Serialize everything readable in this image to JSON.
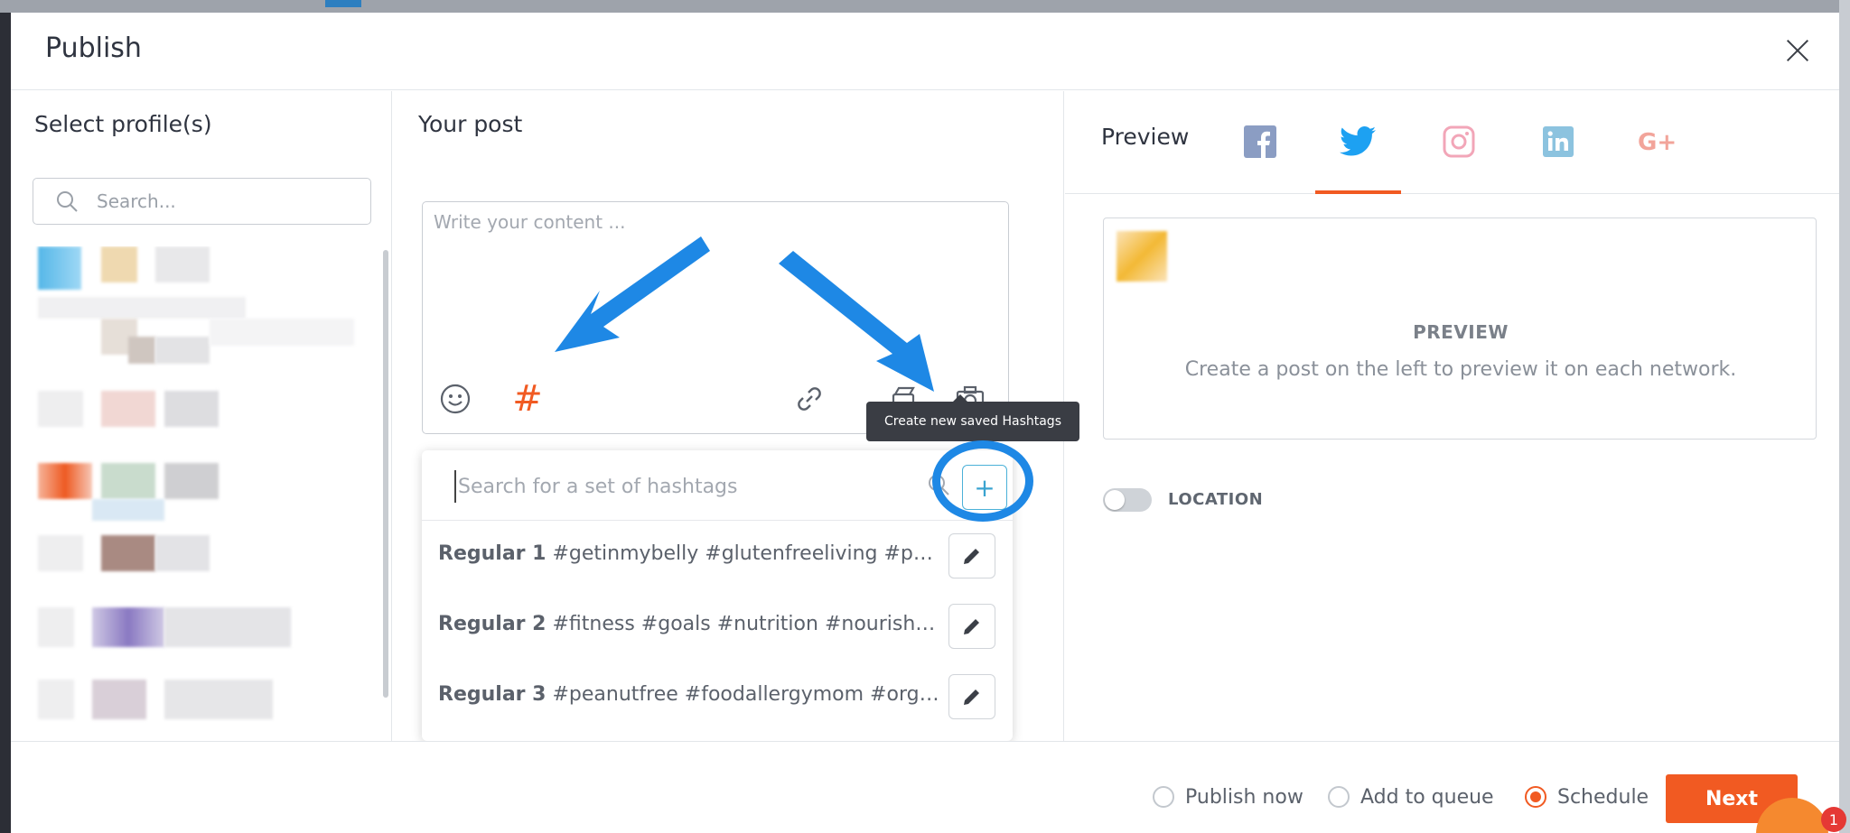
{
  "modal": {
    "title": "Publish",
    "close_icon": "close-icon"
  },
  "left": {
    "heading": "Select profile(s)",
    "search_placeholder": "Search..."
  },
  "middle": {
    "heading": "Your post",
    "content_placeholder": "Write your content ...",
    "hashtag_symbol": "#",
    "tools": [
      "emoji-icon",
      "hashtag-icon",
      "link-icon",
      "video-icon",
      "camera-icon"
    ],
    "tooltip": "Create new saved Hashtags",
    "hashtag_search_placeholder": "Search for a set of hashtags",
    "add_symbol": "+",
    "hashtag_sets": [
      {
        "name": "Regular 1",
        "tags": "#getinmybelly #glutenfreeliving #powerfood #healthychoices"
      },
      {
        "name": "Regular 2",
        "tags": "#fitness #goals #nutrition #nourishyourbody #wellness"
      },
      {
        "name": "Regular 3",
        "tags": "#peanutfree #foodallergymom #organic #kidfriendly"
      }
    ]
  },
  "right": {
    "heading": "Preview",
    "networks": [
      "facebook-icon",
      "twitter-icon",
      "instagram-icon",
      "linkedin-icon",
      "google-plus-icon"
    ],
    "active_network": "twitter",
    "preview_title": "PREVIEW",
    "preview_sub": "Create a post on the left to preview it on each network.",
    "location_label": "LOCATION",
    "location_enabled": false
  },
  "footer": {
    "options": [
      {
        "label": "Publish now",
        "checked": false
      },
      {
        "label": "Add to queue",
        "checked": false
      },
      {
        "label": "Schedule",
        "checked": true
      }
    ],
    "next_label": "Next",
    "chat_badge": "1"
  },
  "colors": {
    "accent": "#f15a22",
    "annotation_blue": "#1e88e5",
    "add_button_border": "#4bb1d8"
  }
}
